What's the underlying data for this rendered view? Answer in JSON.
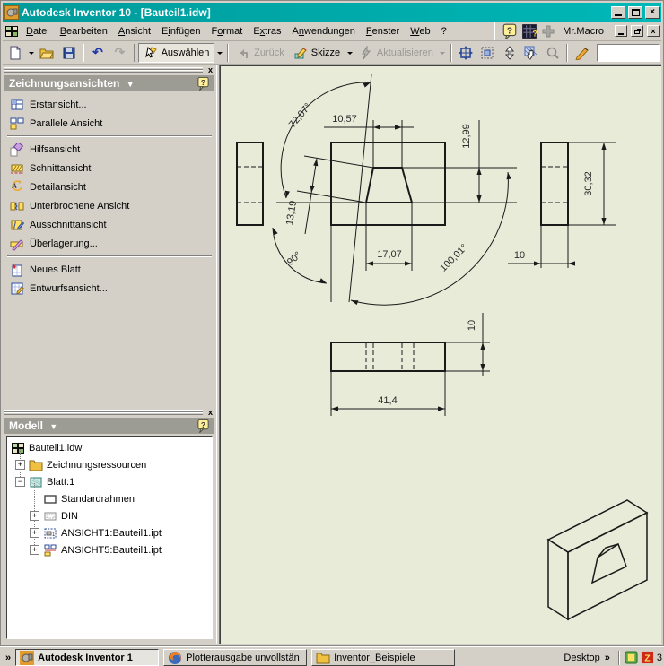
{
  "window": {
    "title": "Autodesk Inventor 10 - [Bauteil1.idw]",
    "close_glyph": "×"
  },
  "menu": {
    "items": [
      {
        "label": "Datei",
        "accel": 0
      },
      {
        "label": "Bearbeiten",
        "accel": 0
      },
      {
        "label": "Ansicht",
        "accel": 0
      },
      {
        "label": "Einfügen",
        "accel": 1
      },
      {
        "label": "Format",
        "accel": 1
      },
      {
        "label": "Extras",
        "accel": 1
      },
      {
        "label": "Anwendungen",
        "accel": 1
      },
      {
        "label": "Fenster",
        "accel": 0
      },
      {
        "label": "Web",
        "accel": 0
      },
      {
        "label": "?",
        "accel": -1
      }
    ],
    "macro_label": "Mr.Macro"
  },
  "toolbar": {
    "select_label": "Auswählen",
    "back_label": "Zurück",
    "sketch_label": "Skizze",
    "update_label": "Aktualisieren",
    "undo_glyph": "↶",
    "redo_glyph": "↷"
  },
  "views_panel": {
    "title": "Zeichnungsansichten",
    "caret": "▼",
    "help_glyph": "?",
    "close_glyph": "x",
    "items": [
      {
        "label": "Erstansicht...",
        "icon": "base-view"
      },
      {
        "label": "Parallele Ansicht",
        "icon": "parallel-view"
      },
      {
        "sep": true
      },
      {
        "label": "Hilfsansicht",
        "icon": "aux-view"
      },
      {
        "label": "Schnittansicht",
        "icon": "section-view"
      },
      {
        "label": "Detailansicht",
        "icon": "detail-view"
      },
      {
        "label": "Unterbrochene Ansicht",
        "icon": "broken-view"
      },
      {
        "label": "Ausschnittansicht",
        "icon": "breakout-view"
      },
      {
        "label": "Überlagerung...",
        "icon": "overlay-view"
      },
      {
        "sep": true
      },
      {
        "label": "Neues Blatt",
        "icon": "new-sheet"
      },
      {
        "label": "Entwurfsansicht...",
        "icon": "draft-view"
      }
    ]
  },
  "model_panel": {
    "title": "Modell",
    "caret": "▼",
    "help_glyph": "?",
    "close_glyph": "x",
    "tree": [
      {
        "label": "Bauteil1.idw",
        "icon": "idw-doc",
        "level": 0,
        "expand": null
      },
      {
        "label": "Zeichnungsressourcen",
        "icon": "res-folder",
        "level": 1,
        "expand": "plus"
      },
      {
        "label": "Blatt:1",
        "icon": "sheet",
        "level": 1,
        "expand": "minus"
      },
      {
        "label": "Standardrahmen",
        "icon": "frame",
        "level": 2,
        "expand": null
      },
      {
        "label": "DIN",
        "icon": "din",
        "level": 2,
        "expand": "plus"
      },
      {
        "label": "ANSICHT1:Bauteil1.ipt",
        "icon": "view1",
        "level": 2,
        "expand": "plus"
      },
      {
        "label": "ANSICHT5:Bauteil1.ipt",
        "icon": "view5",
        "level": 2,
        "expand": "plus"
      }
    ]
  },
  "drawing": {
    "dims": {
      "d1057": "10,57",
      "d1299": "12,99",
      "d3032": "30,32",
      "d1319": "13,19",
      "d1707": "17,07",
      "d414": "41,4",
      "d10_side": "10",
      "d10_bottom": "10",
      "a7207": "72,07°",
      "a90": "90°",
      "a10001": "100,01°"
    }
  },
  "taskbar": {
    "chevron": "»",
    "buttons": [
      {
        "label": "Autodesk Inventor 1",
        "icon": "inv-task",
        "active": true
      },
      {
        "label": "Plotterausgabe unvollstän",
        "icon": "firefox",
        "active": false
      },
      {
        "label": "Inventor_Beispiele",
        "icon": "folder-task",
        "active": false
      }
    ],
    "desktop_label": "Desktop",
    "desktop_chevron": "»",
    "tray_suffix": "3"
  }
}
